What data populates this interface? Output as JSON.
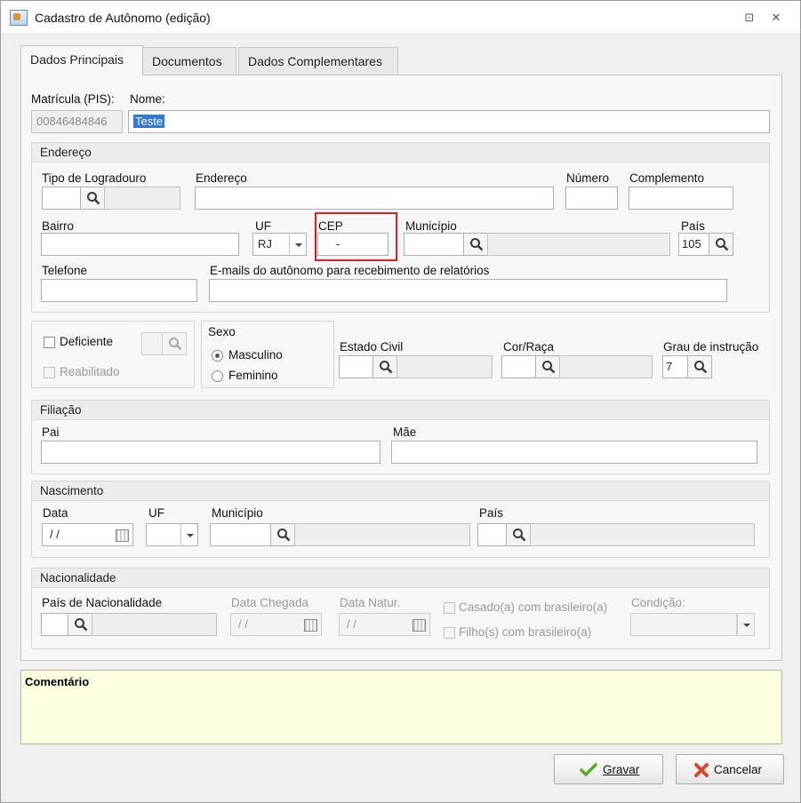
{
  "window": {
    "title": "Cadastro de Autônomo (edição)",
    "restore_glyph": "⊡",
    "close_glyph": "✕"
  },
  "tabs": [
    {
      "label": "Dados Principais",
      "active": true
    },
    {
      "label": "Documentos",
      "active": false
    },
    {
      "label": "Dados Complementares",
      "active": false
    }
  ],
  "identificacao": {
    "matricula_label": "Matrícula (PIS):",
    "matricula_value": "00846484846",
    "nome_label": "Nome:",
    "nome_value": "Teste"
  },
  "endereco": {
    "title": "Endereço",
    "tipo_logradouro_label": "Tipo de Logradouro",
    "endereco_label": "Endereço",
    "numero_label": "Número",
    "complemento_label": "Complemento",
    "bairro_label": "Bairro",
    "uf_label": "UF",
    "uf_value": "RJ",
    "cep_label": "CEP",
    "cep_value": "-",
    "municipio_label": "Município",
    "pais_label": "País",
    "pais_value": "105",
    "telefone_label": "Telefone",
    "emails_label": "E-mails do autônomo para recebimento de relatórios"
  },
  "pessoais": {
    "deficiente_label": "Deficiente",
    "reabilitado_label": "Reabilitado",
    "sexo_title": "Sexo",
    "masculino_label": "Masculino",
    "feminino_label": "Feminino",
    "sexo_selected": "Masculino",
    "estado_civil_label": "Estado Civil",
    "cor_raca_label": "Cor/Raça",
    "grau_instrucao_label": "Grau de instrução",
    "grau_instrucao_value": "7"
  },
  "filiacao": {
    "title": "Filiação",
    "pai_label": "Pai",
    "mae_label": "Mãe"
  },
  "nascimento": {
    "title": "Nascimento",
    "data_label": "Data",
    "data_value": "/ /",
    "uf_label": "UF",
    "municipio_label": "Município",
    "pais_label": "País"
  },
  "nacionalidade": {
    "title": "Nacionalidade",
    "pais_label": "País de Nacionalidade",
    "data_chegada_label": "Data Chegada",
    "data_chegada_value": "/ /",
    "data_natur_label": "Data Natur.",
    "data_natur_value": "/ /",
    "casado_label": "Casado(a) com brasileiro(a)",
    "filhos_label": "Filho(s) com brasileiro(a)",
    "condicao_label": "Condição:"
  },
  "comentario": {
    "title": "Comentário"
  },
  "buttons": {
    "gravar_label": "Gravar",
    "cancelar_label": "Cancelar"
  },
  "colors": {
    "highlight": "#e02020",
    "comment_bg": "#ffffe1",
    "gravar_icon": "#5aa823",
    "cancelar_icon": "#d9482b"
  }
}
